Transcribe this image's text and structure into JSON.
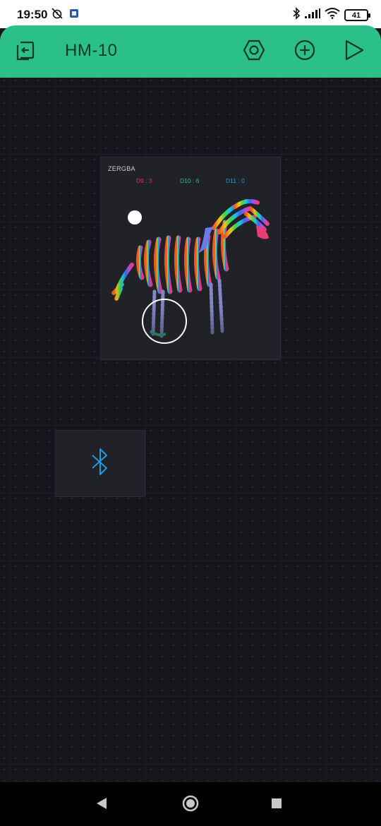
{
  "status_bar": {
    "time": "19:50",
    "battery": "41",
    "icons": [
      "alarm-off-icon",
      "app-notification-icon",
      "bluetooth-icon",
      "signal-icon",
      "wifi-icon",
      "battery-icon"
    ]
  },
  "app_bar": {
    "title": "HM-10",
    "icons": [
      "exit-project-icon",
      "settings-hex-icon",
      "add-widget-icon",
      "play-icon"
    ]
  },
  "zergba": {
    "title": "ZERGBA",
    "pins": {
      "red": "D9 : 3",
      "green": "D10 : 6",
      "blue": "D11 : 0"
    }
  },
  "bluetooth_widget": {
    "icon": "bluetooth-icon"
  },
  "nav_bar": {
    "icons": [
      "back-icon",
      "home-icon",
      "recents-icon"
    ]
  },
  "colors": {
    "accent": "#2bbf8a",
    "background": "#15161b",
    "widget": "#202227",
    "red": "#e0324e",
    "blue": "#1e9be0"
  }
}
